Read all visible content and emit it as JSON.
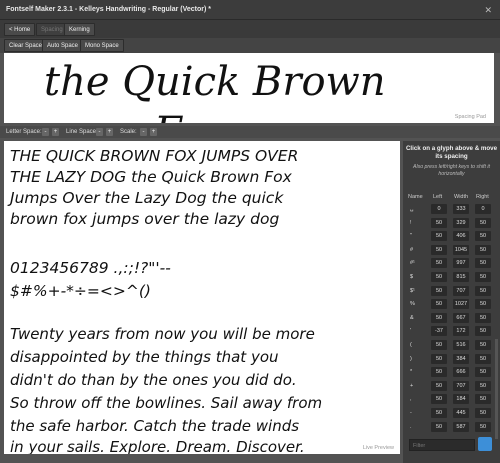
{
  "window": {
    "title": "Fontself Maker 2.3.1 - Kelleys Handwriting - Regular (Vector) *",
    "close": "✕"
  },
  "nav": {
    "home": "< Home",
    "spacing": "Spacing",
    "kerning": "Kerning"
  },
  "toolbar": {
    "clear": "Clear Space",
    "auto": "Auto Space",
    "mono": "Mono Space"
  },
  "spacing_pad": {
    "text": "the Quick Brown",
    "text2": "Fox ...",
    "label": "Spacing Pad"
  },
  "spacebar": {
    "letter": "Letter Space:",
    "line": "Line Space:",
    "scale": "Scale:",
    "minus": "-",
    "plus": "+"
  },
  "preview": {
    "lines": [
      "THE QUICK BROWN FOX JUMPS OVER",
      "THE LAZY DOG the Quick Brown Fox",
      "Jumps Over the Lazy Dog the quick",
      "brown fox jumps over the lazy dog",
      "",
      "0123456789 .,:;!?\"'--",
      "$#%+-*÷=<>^()",
      "",
      "Twenty years from now you will be more",
      "disappointed by the things that you",
      "didn't do than by the ones you did do.",
      "So throw off the bowlines. Sail away from",
      "the safe harbor. Catch the trade winds",
      "in your sails. Explore. Dream. Discover."
    ],
    "label": "Live Preview"
  },
  "side": {
    "instruction": "Click on a glyph above & move its spacing",
    "hint": "Also press left/right keys to shift it horizontally",
    "headers": {
      "name": "Name",
      "left": "Left",
      "width": "Width",
      "right": "Right"
    },
    "rows": [
      {
        "name": "␣",
        "left": "0",
        "width": "333",
        "right": "0"
      },
      {
        "name": "!",
        "left": "50",
        "width": "329",
        "right": "50"
      },
      {
        "name": "\"",
        "left": "50",
        "width": "406",
        "right": "50"
      },
      {
        "name": "#",
        "left": "50",
        "width": "1045",
        "right": "50"
      },
      {
        "name": "#¹",
        "left": "50",
        "width": "997",
        "right": "50"
      },
      {
        "name": "$",
        "left": "50",
        "width": "815",
        "right": "50"
      },
      {
        "name": "$¹",
        "left": "50",
        "width": "707",
        "right": "50"
      },
      {
        "name": "%",
        "left": "50",
        "width": "1027",
        "right": "50"
      },
      {
        "name": "&",
        "left": "50",
        "width": "667",
        "right": "50"
      },
      {
        "name": "'",
        "left": "-37",
        "width": "172",
        "right": "50"
      },
      {
        "name": "(",
        "left": "50",
        "width": "516",
        "right": "50"
      },
      {
        "name": ")",
        "left": "50",
        "width": "384",
        "right": "50"
      },
      {
        "name": "*",
        "left": "50",
        "width": "666",
        "right": "50"
      },
      {
        "name": "+",
        "left": "50",
        "width": "707",
        "right": "50"
      },
      {
        "name": ",",
        "left": "50",
        "width": "184",
        "right": "50"
      },
      {
        "name": "-",
        "left": "50",
        "width": "445",
        "right": "50"
      },
      {
        "name": ".",
        "left": "50",
        "width": "587",
        "right": "50"
      }
    ],
    "filter_placeholder": "Filter"
  },
  "colors": {
    "accent": "#3d8fd8",
    "panel": "#3d3d3d",
    "bg": "#535353"
  }
}
